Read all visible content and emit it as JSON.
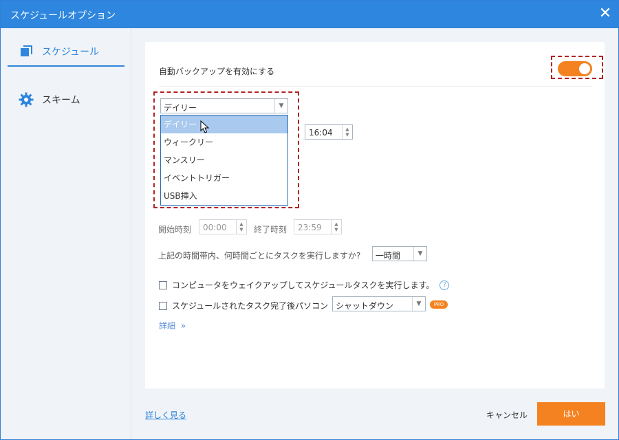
{
  "window": {
    "title": "スケジュールオプション"
  },
  "sidebar": {
    "items": [
      {
        "label": "スケジュール",
        "icon": "copy-icon"
      },
      {
        "label": "スキーム",
        "icon": "gear-icon"
      }
    ]
  },
  "schedule": {
    "enable_label": "自動バックアップを有効にする",
    "enable_on": true,
    "frequency_value": "デイリー",
    "frequency_options": [
      "デイリー",
      "ウィークリー",
      "マンスリー",
      "イベントトリガー",
      "USB挿入"
    ],
    "highlighted_option": "デイリー",
    "time_value": "16:04",
    "start_label": "開始時刻",
    "start_value": "00:00",
    "end_label": "終了時刻",
    "end_value": "23:59",
    "interval_label": "上記の時間帯内、何時間ごとにタスクを実行しますか?",
    "interval_value": "一時間",
    "wake_label": "コンピュータをウェイクアップしてスケジュールタスクを実行します。",
    "after_label": "スケジュールされたタスク完了後パソコン",
    "after_value": "シャットダウン",
    "pro_badge": "PRO",
    "details_label": "詳細"
  },
  "footer": {
    "learn_more": "詳しく見る",
    "cancel": "キャンセル",
    "ok": "はい"
  },
  "colors": {
    "accent": "#2e86de",
    "orange": "#f58220",
    "highlight_border": "#b22222"
  }
}
